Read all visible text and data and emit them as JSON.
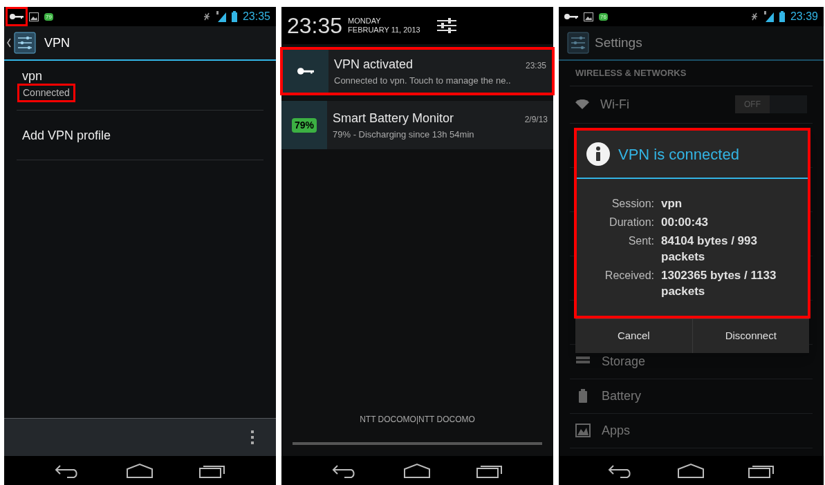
{
  "vpn_screen": {
    "status_bar": {
      "key_highlighted": true,
      "battery_badge": "79",
      "time": "23:35"
    },
    "title": "VPN",
    "profiles": [
      {
        "name": "vpn",
        "status": "Connected",
        "status_highlighted": true
      },
      {
        "name": "Add VPN profile"
      }
    ]
  },
  "notification_screen": {
    "time": "23:35",
    "weekday": "MONDAY",
    "date": "FEBRUARY 11, 2013",
    "notifications": [
      {
        "kind": "vpn",
        "title": "VPN activated",
        "time": "23:35",
        "text": "Connected to vpn. Touch to manage the ne..",
        "highlighted": true
      },
      {
        "kind": "battery",
        "badge": "79%",
        "title": "Smart Battery Monitor",
        "time": "2/9/13",
        "text": "79% - Discharging since 13h 54min",
        "highlighted": false
      }
    ],
    "carrier": "NTT DOCOMO|NTT DOCOMO"
  },
  "settings_screen": {
    "status_bar": {
      "battery_badge": "76",
      "time": "23:39"
    },
    "title": "Settings",
    "section": "WIRELESS & NETWORKS",
    "wifi": {
      "label": "Wi-Fi",
      "toggle": "OFF",
      "on": false
    },
    "items": [
      {
        "kind": "storage",
        "label": "Storage"
      },
      {
        "kind": "battery",
        "label": "Battery"
      },
      {
        "kind": "apps",
        "label": "Apps"
      }
    ],
    "dialog": {
      "title": "VPN is connected",
      "highlighted": true,
      "rows": [
        {
          "label": "Session:",
          "value": "vpn"
        },
        {
          "label": "Duration:",
          "value": "00:00:43"
        },
        {
          "label": "Sent:",
          "value": "84104 bytes / 993 packets"
        },
        {
          "label": "Received:",
          "value": "1302365 bytes / 1133 packets"
        }
      ],
      "buttons": [
        "Cancel",
        "Disconnect"
      ]
    }
  }
}
